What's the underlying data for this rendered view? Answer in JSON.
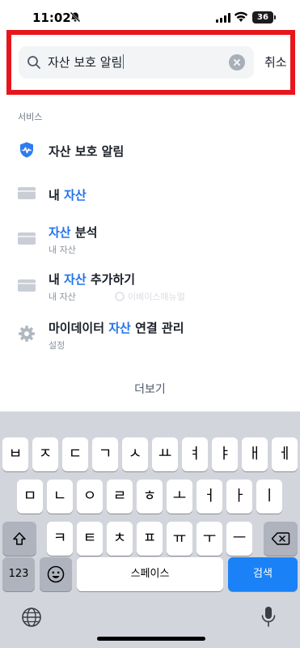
{
  "status_bar": {
    "time": "11:02",
    "battery": "36"
  },
  "search": {
    "query": "자산 보호 알림",
    "cancel_label": "취소"
  },
  "section_label": "서비스",
  "results": [
    {
      "title_parts": [
        "자산",
        " 보호 알림"
      ],
      "highlight_first": true,
      "all_highlight": true,
      "icon": "shield-icon",
      "sub": ""
    },
    {
      "title_pre": "내 ",
      "title_hl": "자산",
      "title_post": "",
      "icon": "card-icon",
      "sub": ""
    },
    {
      "title_pre": "",
      "title_hl": "자산",
      "title_post": " 분석",
      "icon": "card-icon",
      "sub": "내 자산"
    },
    {
      "title_pre": "내 ",
      "title_hl": "자산",
      "title_post": " 추가하기",
      "icon": "card-icon",
      "sub": "내 자산"
    },
    {
      "title_pre": "마이데이터 ",
      "title_hl": "자산",
      "title_post": " 연결 관리",
      "icon": "gear-icon",
      "sub": "설정"
    }
  ],
  "watermark": "이베이스매뉴얼",
  "more_label": "더보기",
  "keyboard": {
    "row1": [
      "ㅂ",
      "ㅈ",
      "ㄷ",
      "ㄱ",
      "ㅅ",
      "ㅛ",
      "ㅕ",
      "ㅑ",
      "ㅐ",
      "ㅔ"
    ],
    "row2": [
      "ㅁ",
      "ㄴ",
      "ㅇ",
      "ㄹ",
      "ㅎ",
      "ㅗ",
      "ㅓ",
      "ㅏ",
      "ㅣ"
    ],
    "row3": [
      "ㅋ",
      "ㅌ",
      "ㅊ",
      "ㅍ",
      "ㅠ",
      "ㅜ",
      "ㅡ"
    ],
    "numbers_label": "123",
    "space_label": "스페이스",
    "return_label": "검색"
  },
  "colors": {
    "accent": "#2272eb",
    "highlight_border": "#e8161c",
    "return_key": "#1a82f6"
  }
}
